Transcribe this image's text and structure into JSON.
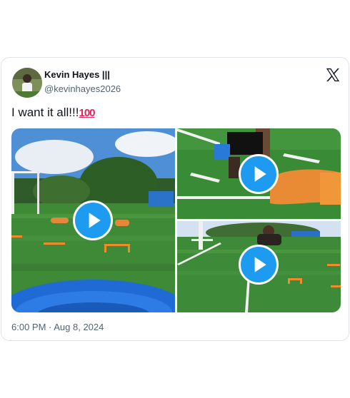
{
  "tweet": {
    "author_name": "Kevin Hayes |||",
    "author_handle": "@kevinhayes2026",
    "text": "I want it all!!!",
    "emoji": "100",
    "timestamp": "6:00 PM · Aug 8, 2024"
  },
  "icons": {
    "platform": "x-logo-icon",
    "media_play": "play-icon"
  },
  "colors": {
    "accent": "#1d9bf0",
    "text": "#0f1419",
    "muted": "#536471",
    "emoji": "#e0245e"
  }
}
